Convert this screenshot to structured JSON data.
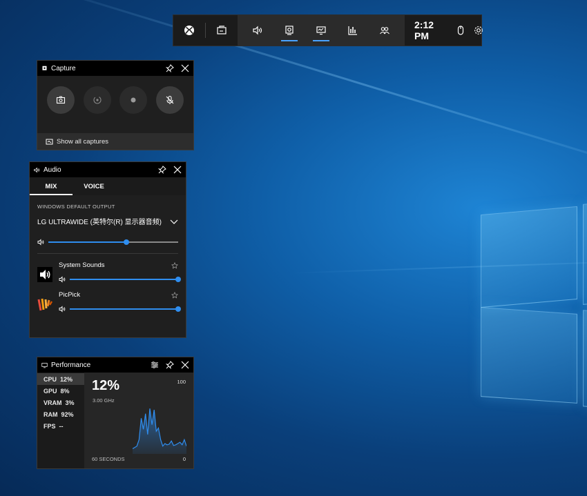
{
  "topbar": {
    "time": "2:12 PM",
    "buttons": [
      "xbox-icon",
      "widget-menu-icon",
      "audio-icon",
      "capture-icon",
      "performance-icon",
      "resources-icon",
      "social-icon",
      "mouse-icon",
      "settings-icon"
    ]
  },
  "capture": {
    "title": "Capture",
    "show_all": "Show all captures"
  },
  "audio": {
    "title": "Audio",
    "tabs": [
      "MIX",
      "VOICE"
    ],
    "output_label": "WINDOWS DEFAULT OUTPUT",
    "device": "LG ULTRAWIDE (英特尔(R) 显示器音频)",
    "master_volume": 0.6,
    "apps": [
      {
        "name": "System Sounds",
        "volume": 1.0
      },
      {
        "name": "PicPick",
        "volume": 1.0
      }
    ]
  },
  "performance": {
    "title": "Performance",
    "metrics": [
      {
        "label": "CPU",
        "value": "12%"
      },
      {
        "label": "GPU",
        "value": "8%"
      },
      {
        "label": "VRAM",
        "value": "3%"
      },
      {
        "label": "RAM",
        "value": "92%"
      },
      {
        "label": "FPS",
        "value": "--"
      }
    ],
    "current": "12%",
    "frequency": "3.00 GHz",
    "max_label": "100",
    "min_label": "0",
    "window_label": "60 SECONDS",
    "history": [
      8,
      10,
      12,
      22,
      55,
      38,
      62,
      30,
      70,
      45,
      68,
      35,
      40,
      22,
      12,
      16,
      14,
      15,
      20,
      13,
      14,
      16,
      18,
      14,
      22,
      12
    ]
  }
}
